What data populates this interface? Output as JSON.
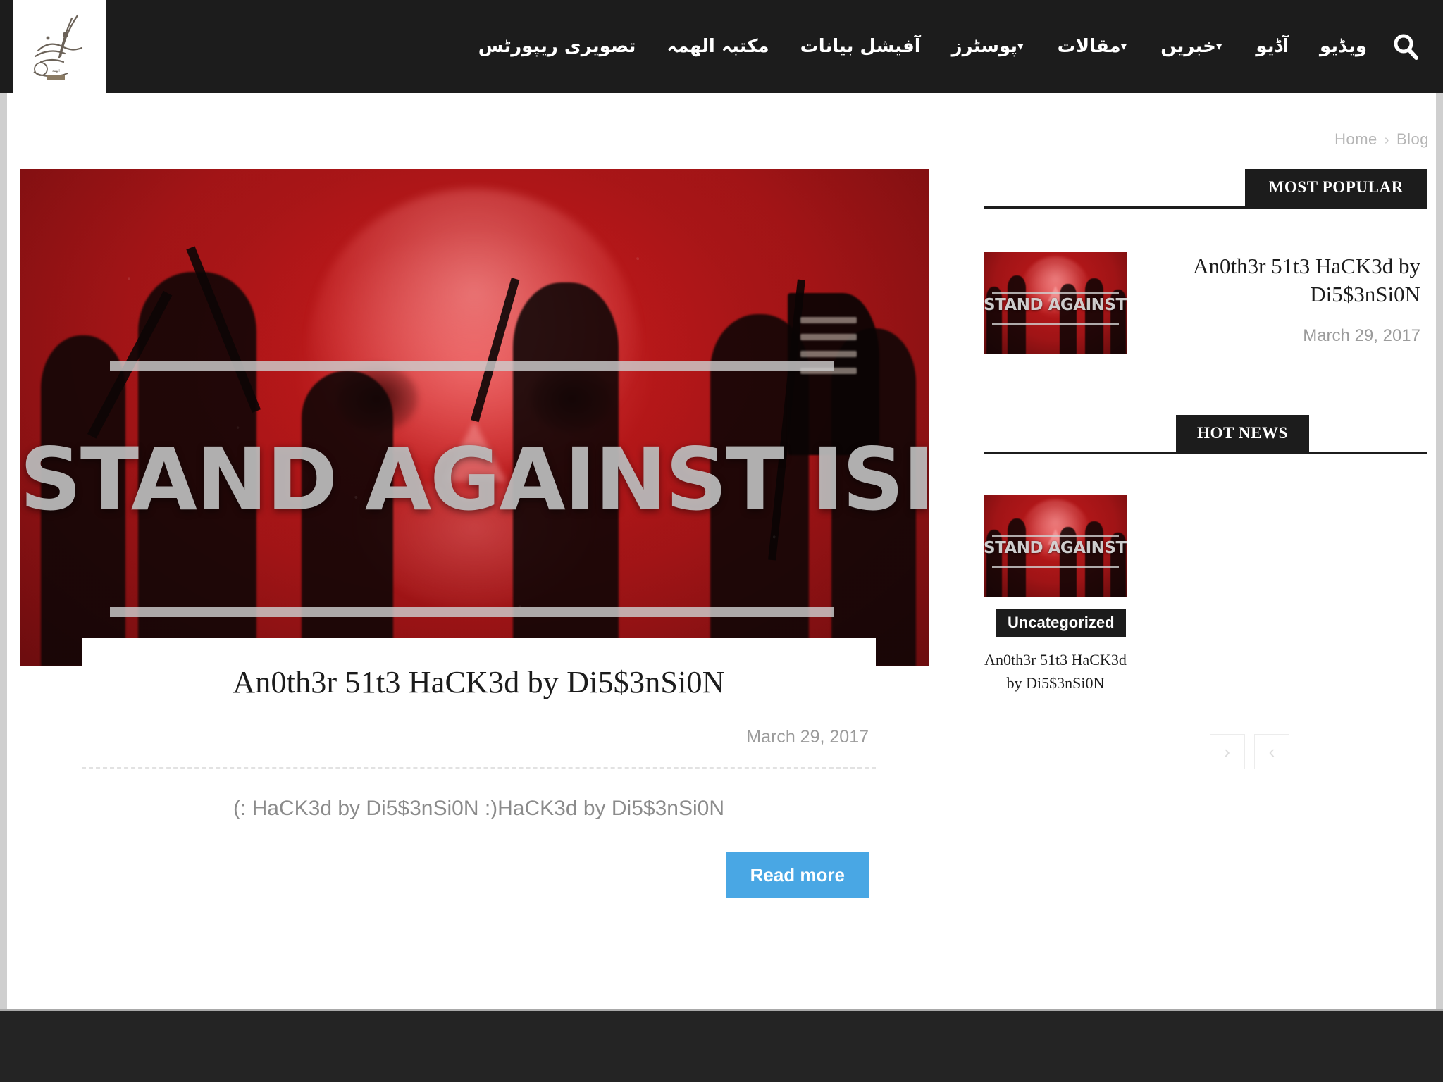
{
  "site": {
    "logo_alt": "site-logo-arabic-calligraphy",
    "header_bg": "#1c1c1c",
    "accent_blue": "#49a7e4"
  },
  "nav": {
    "items": [
      {
        "label": "ویڈیو",
        "has_caret": false
      },
      {
        "label": "آڈیو",
        "has_caret": false
      },
      {
        "label": "خبریں",
        "has_caret": true
      },
      {
        "label": "مقالات",
        "has_caret": true
      },
      {
        "label": "پوسٹرز",
        "has_caret": true
      },
      {
        "label": "آفیشل بیانات",
        "has_caret": false
      },
      {
        "label": "مکتبہ الھمہ",
        "has_caret": false
      },
      {
        "label": "تصویری ریپورٹس",
        "has_caret": false
      }
    ],
    "search_icon": "search-icon"
  },
  "breadcrumb": {
    "home": "Home",
    "separator": "›",
    "current": "Blog"
  },
  "article": {
    "hero_image_text": "STAND AGAINST ISIS!",
    "title": "An0th3r 51t3 HaCK3d by Di5$3nSi0N",
    "date": "March 29, 2017",
    "excerpt": "(: HaCK3d by Di5$3nSi0N :)HaCK3d by Di5$3nSi0N",
    "read_more_label": "Read more"
  },
  "sidebar": {
    "most_popular": {
      "heading": "MOST POPULAR",
      "items": [
        {
          "thumb_text": "STAND AGAINST ISIS!",
          "title": "An0th3r 51t3 HaCK3d by Di5$3nSi0N",
          "date": "March 29, 2017"
        }
      ]
    },
    "hot_news": {
      "heading": "HOT NEWS",
      "items": [
        {
          "thumb_text": "STAND AGAINST ISIS!",
          "category": "Uncategorized",
          "title": "An0th3r 51t3 HaCK3d by Di5$3nSi0N"
        }
      ],
      "pager": {
        "next_label": "›",
        "prev_label": "‹"
      }
    }
  }
}
